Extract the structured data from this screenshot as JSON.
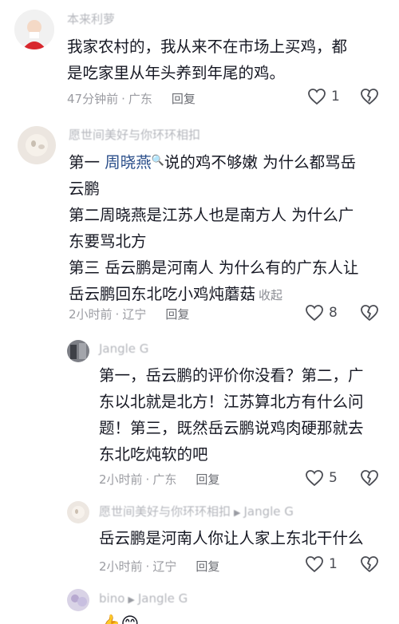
{
  "comments": [
    {
      "username": "本来利萝",
      "lines": [
        "我家农村的，我从来不在市场上买鸡，都",
        "是吃家里从年头养到年尾的鸡。"
      ],
      "time": "47分钟前",
      "location": "广东",
      "reply_label": "回复",
      "likes": "1"
    },
    {
      "username": "愿世间美好与你环环相扣",
      "line1_prefix": "第一 ",
      "mention": "周晓燕",
      "line1_suffix": "说的鸡不够嫩 为什么都骂岳",
      "lines_rest": [
        "云鹏",
        "第二周晓燕是江苏人也是南方人 为什么广",
        "东要骂北方",
        "第三 岳云鹏是河南人 为什么有的广东人让"
      ],
      "last_line": "岳云鹏回东北吃小鸡炖蘑菇",
      "collapse_label": "收起",
      "time": "2小时前",
      "location": "辽宁",
      "reply_label": "回复",
      "likes": "8"
    },
    {
      "username": "Jangle G",
      "lines": [
        "第一，岳云鹏的评价你没看？第二，广",
        "东以北就是北方！江苏算北方有什么问",
        "题！第三，既然岳云鹏说鸡肉硬那就去",
        "东北吃炖软的吧"
      ],
      "time": "2小时前",
      "location": "广东",
      "reply_label": "回复",
      "likes": "5"
    },
    {
      "username": "愿世间美好与你环环相扣",
      "reply_to": "Jangle G",
      "lines": [
        "岳云鹏是河南人你让人家上东北干什么"
      ],
      "time": "2小时前",
      "location": "辽宁",
      "reply_label": "回复",
      "likes": "1"
    },
    {
      "username": "bino",
      "reply_to": "Jangle G",
      "emoji_line": "👍😊"
    }
  ],
  "separator": "·",
  "colors": {
    "text": "#161823",
    "meta": "#9b9ca2",
    "mention": "#2a4e8a"
  }
}
